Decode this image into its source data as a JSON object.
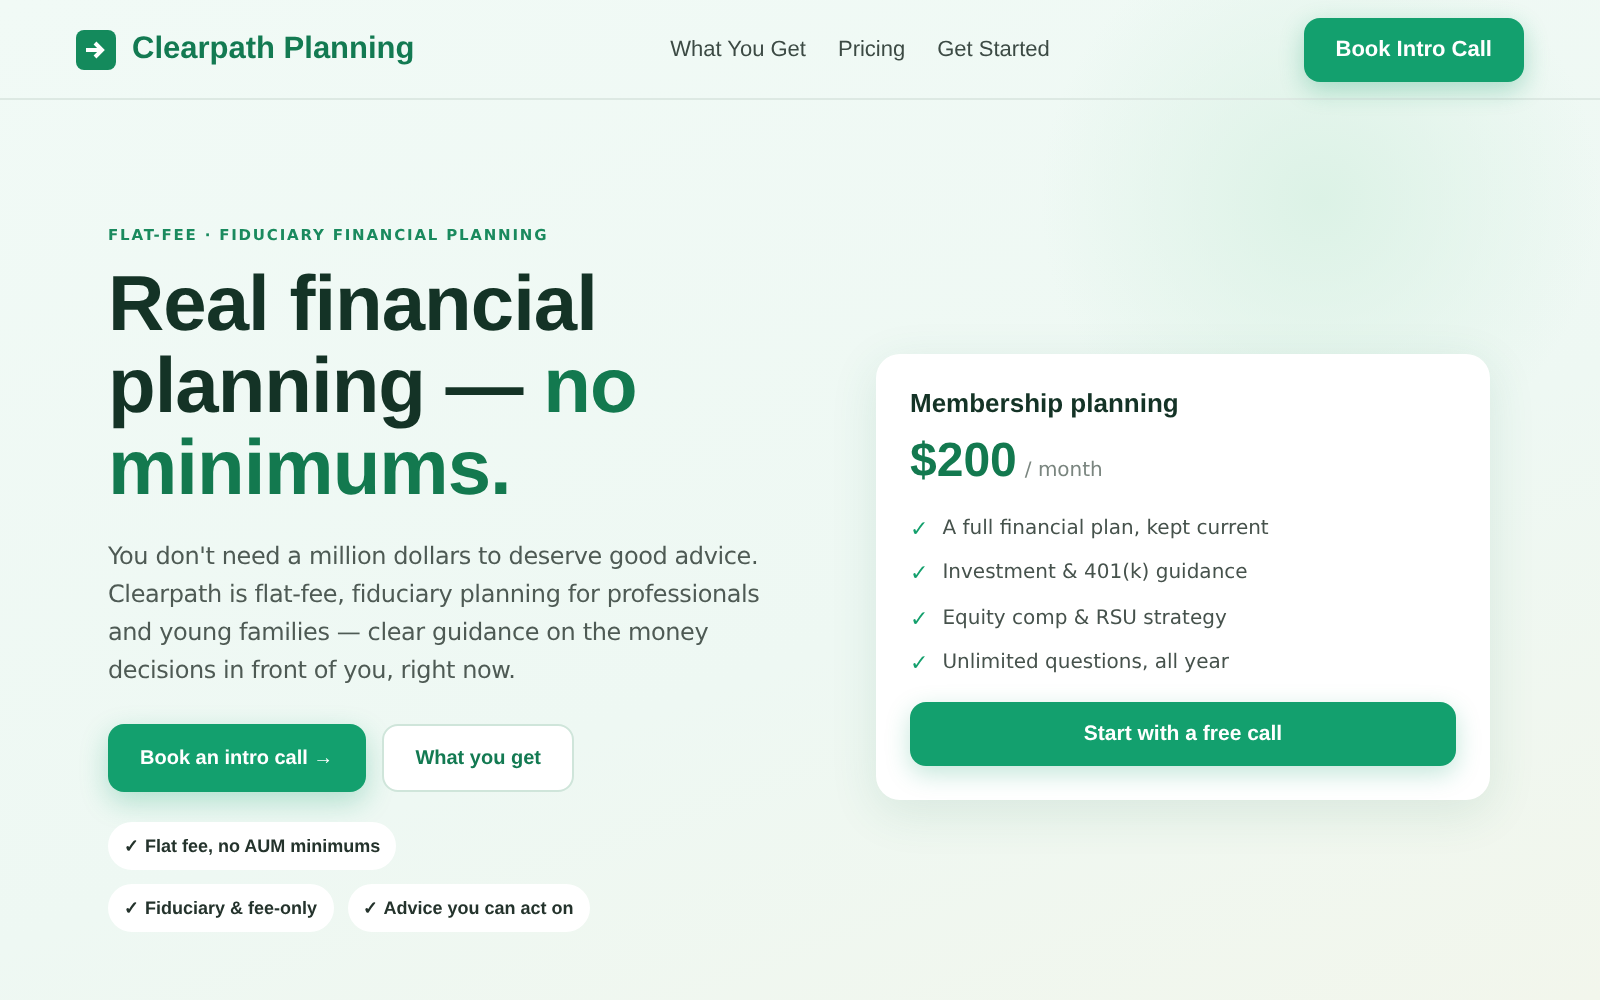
{
  "header": {
    "brand": "Clearpath Planning",
    "nav": [
      "What You Get",
      "Pricing",
      "Get Started"
    ],
    "cta": "Book Intro Call"
  },
  "hero": {
    "eyebrow": "FLAT-FEE · FIDUCIARY FINANCIAL PLANNING",
    "headline": "Real financial planning — **no minimums.**",
    "intro": "You don't need a million dollars to deserve good advice. Clearpath is flat-fee, fiduciary planning for professionals and young families — clear guidance on the money decisions in front of you, right now.",
    "buttons": [
      {
        "label": "Book an intro call →",
        "kind": "primary"
      },
      {
        "label": "What you get",
        "kind": "secondary"
      }
    ],
    "chips": [
      "✓ Flat fee, no AUM minimums",
      "✓ Fiduciary & fee-only",
      "✓ Advice you can act on"
    ]
  },
  "card": {
    "title": "Membership planning",
    "price": "$200",
    "period": "/ month",
    "features": [
      {
        "mark": "✓",
        "text": "A full financial plan, kept current"
      },
      {
        "mark": "✓",
        "text": "Investment & 401(k) guidance"
      },
      {
        "mark": "✓",
        "text": "Equity comp & RSU strategy"
      },
      {
        "mark": "✓",
        "text": "Unlimited questions, all year"
      }
    ],
    "button": "Start with a free call"
  }
}
